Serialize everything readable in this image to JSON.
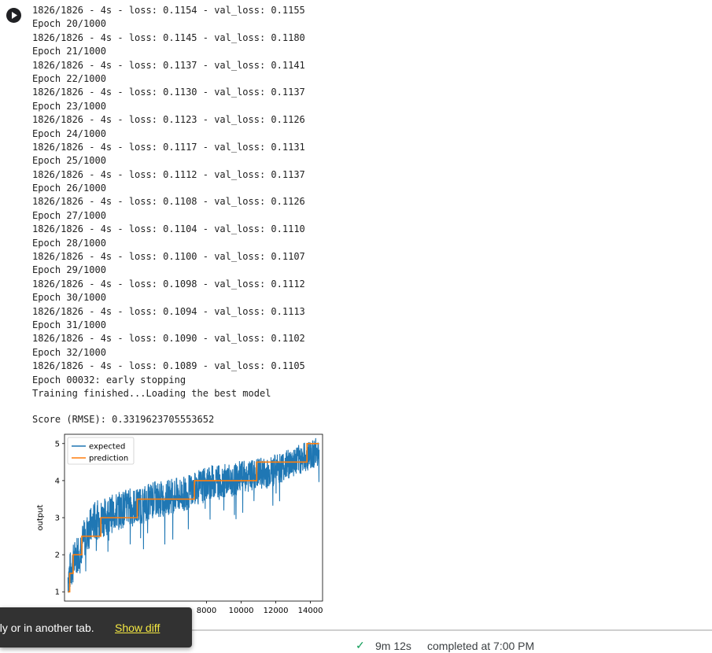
{
  "cell": {
    "run_button_icon": "play-icon"
  },
  "output": {
    "lines": [
      "1826/1826 - 4s - loss: 0.1154 - val_loss: 0.1155",
      "Epoch 20/1000",
      "1826/1826 - 4s - loss: 0.1145 - val_loss: 0.1180",
      "Epoch 21/1000",
      "1826/1826 - 4s - loss: 0.1137 - val_loss: 0.1141",
      "Epoch 22/1000",
      "1826/1826 - 4s - loss: 0.1130 - val_loss: 0.1137",
      "Epoch 23/1000",
      "1826/1826 - 4s - loss: 0.1123 - val_loss: 0.1126",
      "Epoch 24/1000",
      "1826/1826 - 4s - loss: 0.1117 - val_loss: 0.1131",
      "Epoch 25/1000",
      "1826/1826 - 4s - loss: 0.1112 - val_loss: 0.1137",
      "Epoch 26/1000",
      "1826/1826 - 4s - loss: 0.1108 - val_loss: 0.1126",
      "Epoch 27/1000",
      "1826/1826 - 4s - loss: 0.1104 - val_loss: 0.1110",
      "Epoch 28/1000",
      "1826/1826 - 4s - loss: 0.1100 - val_loss: 0.1107",
      "Epoch 29/1000",
      "1826/1826 - 4s - loss: 0.1098 - val_loss: 0.1112",
      "Epoch 30/1000",
      "1826/1826 - 4s - loss: 0.1094 - val_loss: 0.1113",
      "Epoch 31/1000",
      "1826/1826 - 4s - loss: 0.1090 - val_loss: 0.1102",
      "Epoch 32/1000",
      "1826/1826 - 4s - loss: 0.1089 - val_loss: 0.1105",
      "Epoch 00032: early stopping",
      "Training finished...Loading the best model"
    ],
    "score": "Score (RMSE): 0.3319623705553652"
  },
  "chart_data": {
    "type": "line",
    "ylabel": "output",
    "xlabel": "",
    "xlim": [
      -200,
      14700
    ],
    "ylim": [
      0.75,
      5.25
    ],
    "yticks": [
      1,
      2,
      3,
      4,
      5
    ],
    "xticks_visible": [
      8000,
      10000,
      12000,
      14000
    ],
    "legend": [
      "expected",
      "prediction"
    ],
    "legend_position": "upper-left",
    "series": [
      {
        "name": "expected",
        "color": "#1f77b4",
        "x": [
          0,
          500,
          1000,
          1500,
          2000,
          2500,
          3000,
          3500,
          4000,
          4500,
          5000,
          5500,
          6000,
          6500,
          7000,
          7500,
          8000,
          8500,
          9000,
          9500,
          10000,
          10500,
          11000,
          11500,
          12000,
          12500,
          13000,
          13500,
          14000,
          14500
        ],
        "y": [
          1.4,
          2.0,
          2.5,
          2.9,
          3.0,
          3.1,
          3.2,
          3.3,
          3.3,
          3.4,
          3.5,
          3.5,
          3.6,
          3.6,
          3.7,
          3.8,
          3.9,
          4.0,
          4.0,
          4.0,
          4.1,
          4.1,
          4.2,
          4.2,
          4.3,
          4.4,
          4.5,
          4.6,
          4.7,
          4.8
        ]
      },
      {
        "name": "prediction",
        "color": "#ff7f0e",
        "steps": [
          [
            0,
            1.0
          ],
          [
            100,
            1.5
          ],
          [
            300,
            2.0
          ],
          [
            800,
            2.5
          ],
          [
            1900,
            3.0
          ],
          [
            4000,
            3.5
          ],
          [
            7300,
            4.0
          ],
          [
            10900,
            4.5
          ],
          [
            13800,
            5.0
          ],
          [
            14500,
            5.0
          ]
        ]
      }
    ]
  },
  "status": {
    "check_icon": "check-icon",
    "elapsed": "9m 12s",
    "completed": "completed at 7:00 PM"
  },
  "toast": {
    "message": "ely or in another tab.",
    "action": "Show diff"
  }
}
